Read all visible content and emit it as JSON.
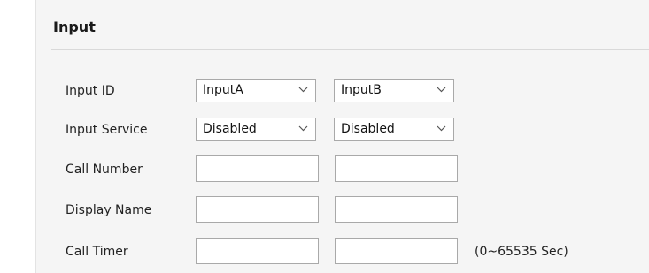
{
  "section": {
    "title": "Input"
  },
  "rows": {
    "input_id": {
      "label": "Input ID",
      "a_value": "InputA",
      "b_value": "InputB"
    },
    "input_service": {
      "label": "Input Service",
      "a_value": "Disabled",
      "b_value": "Disabled"
    },
    "call_number": {
      "label": "Call Number",
      "a_value": "",
      "b_value": ""
    },
    "display_name": {
      "label": "Display Name",
      "a_value": "",
      "b_value": ""
    },
    "call_timer": {
      "label": "Call Timer",
      "a_value": "",
      "b_value": "",
      "hint": "(0~65535 Sec)"
    }
  },
  "icons": {
    "dropdown": "chevron-down-icon"
  },
  "colors": {
    "panel_background": "#f5f5f5",
    "field_border": "#a9a9a9"
  }
}
